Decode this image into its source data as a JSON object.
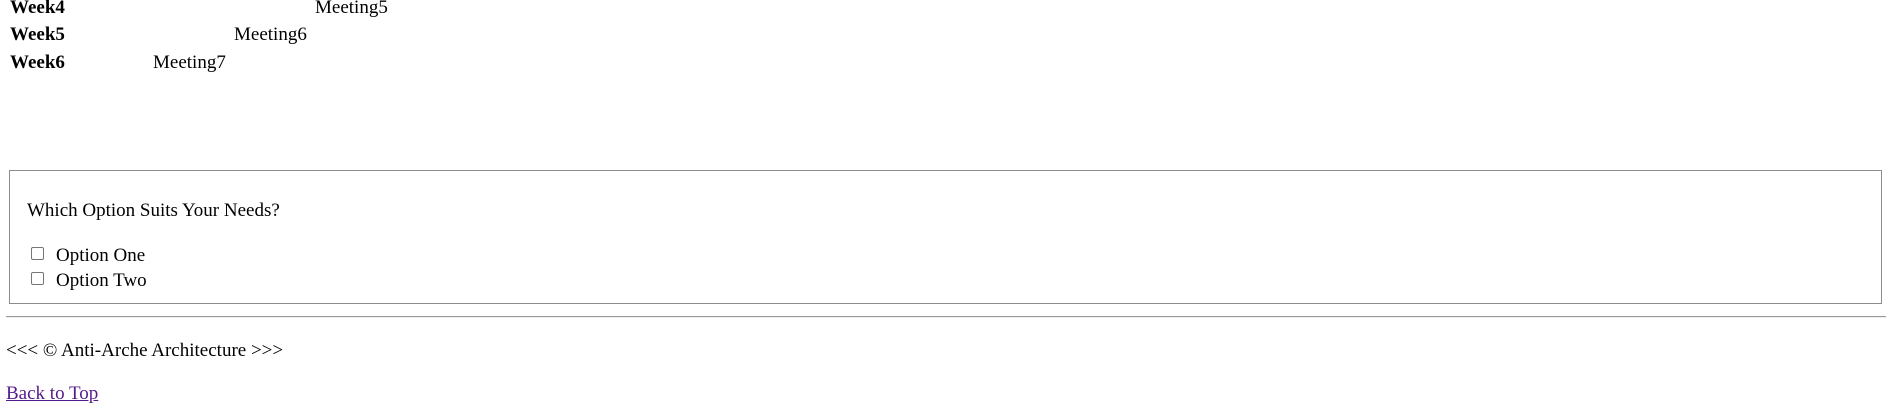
{
  "schedule": {
    "rows": [
      {
        "week": "Week4",
        "meeting": "Meeting5"
      },
      {
        "week": "Week5",
        "meeting": "Meeting6"
      },
      {
        "week": "Week6",
        "meeting": "Meeting7"
      }
    ]
  },
  "options": {
    "question": "Which Option Suits Your Needs?",
    "items": [
      {
        "label": "Option One",
        "checked": false
      },
      {
        "label": "Option Two",
        "checked": false
      }
    ]
  },
  "footer": {
    "text": "<<< © Anti-Arche Architecture >>>",
    "back_to_top": "Back to Top"
  },
  "colors": {
    "link_visited": "#551a8b",
    "border": "#8c8c8c"
  }
}
